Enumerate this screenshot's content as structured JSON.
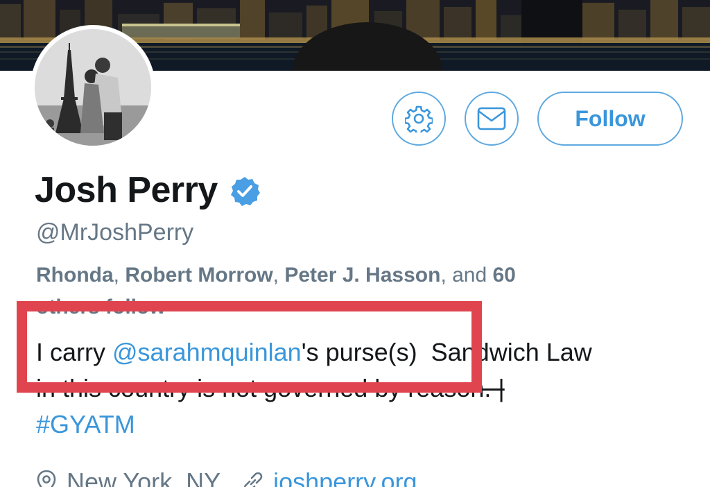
{
  "profile": {
    "display_name": "Josh Perry",
    "handle": "@MrJoshPerry",
    "verified": true,
    "verified_icon": "verified-badge-icon"
  },
  "actions": {
    "settings_icon": "gear-icon",
    "message_icon": "envelope-icon",
    "follow_label": "Follow"
  },
  "followed_by": {
    "name_1": "Rhonda",
    "sep_1": ", ",
    "name_2": "Robert Morrow",
    "sep_2": ", ",
    "name_3": "Peter J. Hasson",
    "and_text": ", and ",
    "count": "60",
    "others_text": "others follow"
  },
  "bio": {
    "part_1": "I carry ",
    "mention": "@sarahmquinlan",
    "part_2": "'s purse(s)",
    "part_3": "  Sandwich Law",
    "part_4": "in this country is not governed by reason. |",
    "hashtag": "#GYATM"
  },
  "meta": {
    "location": "New York, NY",
    "location_icon": "location-pin-icon",
    "website": "joshperry.org",
    "link_icon": "link-icon"
  },
  "colors": {
    "accent": "#3a96db",
    "border_accent": "#5ea9e0",
    "highlight": "#e0454f",
    "secondary_text": "#657786",
    "primary_text": "#14171a"
  }
}
